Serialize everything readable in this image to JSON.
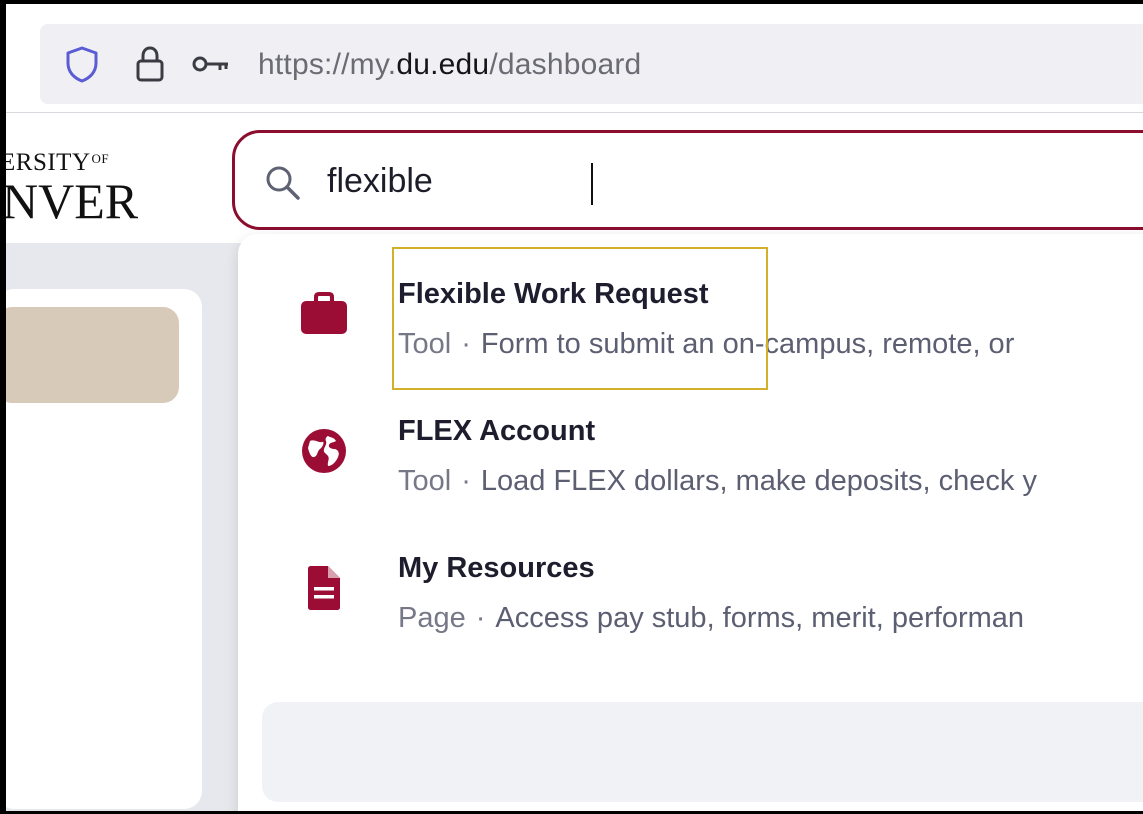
{
  "browser": {
    "url_prefix": "https://my.",
    "url_domain": "du.edu",
    "url_path": "/dashboard"
  },
  "logo": {
    "top_text": "ERSITY",
    "of_text": "OF",
    "bottom_text": "NVER"
  },
  "search": {
    "value": "flexible",
    "icon": "search-icon"
  },
  "results": [
    {
      "title": "Flexible Work Request",
      "type": "Tool",
      "separator": "·",
      "description": "Form to submit an on-campus, remote, or",
      "icon": "briefcase-icon"
    },
    {
      "title": "FLEX Account",
      "type": "Tool",
      "separator": "·",
      "description": "Load FLEX dollars, make deposits, check y",
      "icon": "globe-icon"
    },
    {
      "title": "My Resources",
      "type": "Page",
      "separator": "·",
      "description": "Access pay stub, forms, merit, performan",
      "icon": "document-icon"
    }
  ],
  "colors": {
    "accent": "#8b0e2f",
    "highlight": "#d3b02a",
    "side_pill": "#d8cab8"
  }
}
